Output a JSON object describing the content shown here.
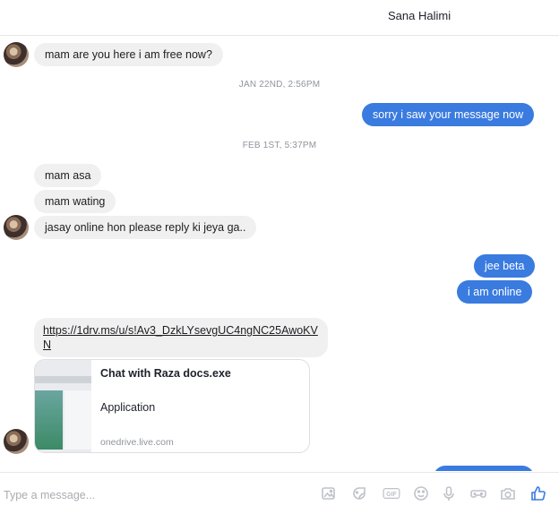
{
  "header": {
    "contact_name": "Sana Halimi"
  },
  "messages": {
    "m1": "mam are you here i am free now?",
    "stamp1": "JAN 22ND, 2:56PM",
    "m2": "sorry i saw your message now",
    "stamp2": "FEB 1ST, 5:37PM",
    "m3": "mam asa",
    "m4": "mam wating",
    "m5": "jasay online hon please reply ki jeya ga..",
    "m6": "jee beta",
    "m7": "i am online",
    "link": "https://1drv.ms/u/s!Av3_DzkLYsevgUC4ngNC25AwoKVN"
  },
  "attachment": {
    "title": "Chat with Raza docs.exe",
    "subtitle": "Application",
    "domain": "onedrive.live.com"
  },
  "composer": {
    "placeholder": "Type a message...",
    "tools": [
      "image-icon",
      "sticker-icon",
      "gif-icon",
      "emoji-icon",
      "microphone-icon",
      "game-controller-icon",
      "camera-icon",
      "thumbs-up-icon"
    ],
    "gif_label": "GIF"
  },
  "colors": {
    "outgoing": "#3a7be0",
    "incoming": "#f1f0f0",
    "accent": "#3a7be0"
  }
}
